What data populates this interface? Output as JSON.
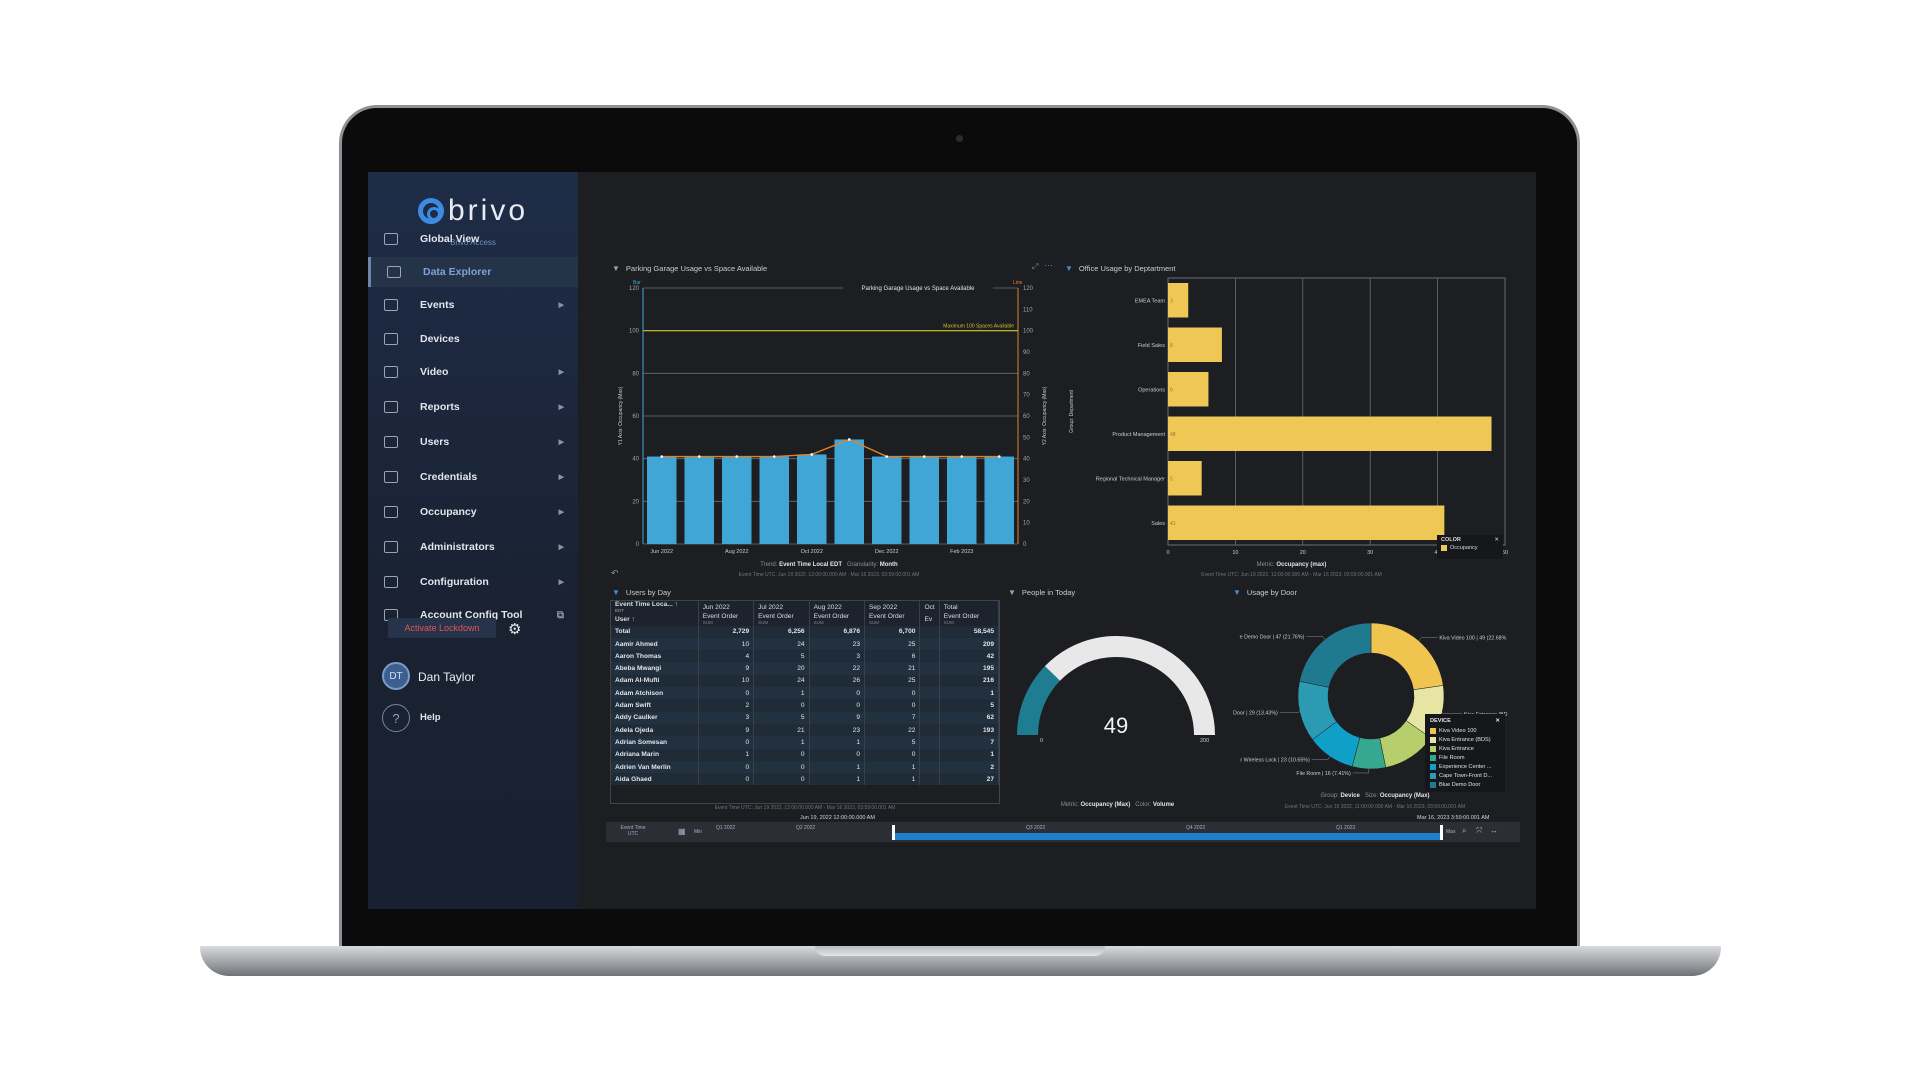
{
  "brand": {
    "name": "brivo",
    "subtitle": "Brivo Access"
  },
  "sidebar": {
    "items": [
      {
        "label": "Global View",
        "icon": "globe-icon",
        "chevron": false
      },
      {
        "label": "Data Explorer",
        "icon": "database-search-icon",
        "chevron": false,
        "active": true
      },
      {
        "label": "Events",
        "icon": "chat-icon",
        "chevron": true
      },
      {
        "label": "Devices",
        "icon": "server-icon",
        "chevron": false
      },
      {
        "label": "Video",
        "icon": "video-icon",
        "chevron": true
      },
      {
        "label": "Reports",
        "icon": "book-icon",
        "chevron": true
      },
      {
        "label": "Users",
        "icon": "user-icon",
        "chevron": true
      },
      {
        "label": "Credentials",
        "icon": "id-card-icon",
        "chevron": true
      },
      {
        "label": "Occupancy",
        "icon": "occupancy-icon",
        "chevron": true
      },
      {
        "label": "Administrators",
        "icon": "admin-icon",
        "chevron": true
      },
      {
        "label": "Configuration",
        "icon": "toolbox-icon",
        "chevron": true
      },
      {
        "label": "Account Config Tool",
        "icon": "brivo-icon",
        "external": true
      }
    ],
    "lockdown_label": "Activate Lockdown",
    "user_initials": "DT",
    "user_name": "Dan Taylor",
    "help_label": "Help"
  },
  "panels": {
    "parking": {
      "title": "Parking Garage Usage vs Space Available",
      "footer_trend_label": "Trend:",
      "footer_trend": "Event Time Local EDT",
      "footer_gran_label": "Granularity:",
      "footer_gran": "Month",
      "footer_time": "Event Time UTC: Jun 19 2022, 12:00:00.000 AM - Mar 16 2023, 03:59:00.001 AM"
    },
    "office": {
      "title": "Office Usage by Deptartment",
      "footer_metric_label": "Metric:",
      "footer_metric": "Occupancy (max)",
      "footer_time": "Event Time UTC: Jun 19 2022, 12:00:00.000 AM - Mar 16 2023, 03:59:00.001 AM",
      "legend_title": "COLOR",
      "legend_item": "Occupancy"
    },
    "users": {
      "title": "Users by Day",
      "footer_time": "Event Time UTC: Jun 19 2022, 12:00:00.000 AM - Mar 16 2023, 03:59:00.001 AM"
    },
    "people": {
      "title": "People in Today",
      "footer_metric_label": "Metric:",
      "footer_metric": "Occupancy (Max)",
      "footer_color_label": "Color:",
      "footer_color": "Volume"
    },
    "door": {
      "title": "Usage by Door",
      "footer_group_label": "Group:",
      "footer_group": "Device",
      "footer_size_label": "Size:",
      "footer_size": "Occupancy (Max)",
      "footer_time": "Event Time UTC: Jun 19 2022, 11:00:00.000 AM - Mar 16 2023, 03:59:00.001 AM",
      "legend_title": "DEVICE"
    }
  },
  "table": {
    "corner_top": "Event Time Loca...",
    "corner_top_sub": "EDT",
    "corner_user": "User",
    "months": [
      "Jun 2022",
      "Jul 2022",
      "Aug 2022",
      "Sep 2022",
      "Oct",
      "Total"
    ],
    "measure": "Event Order",
    "measure_sub": "SUM",
    "measure_trunc": "Ev",
    "rows": [
      [
        "Total",
        "2,729",
        "6,256",
        "6,876",
        "6,700",
        "",
        "58,545"
      ],
      [
        "Aamir Ahmed",
        "10",
        "24",
        "23",
        "25",
        "",
        "209"
      ],
      [
        "Aaron Thomas",
        "4",
        "5",
        "3",
        "6",
        "",
        "42"
      ],
      [
        "Abeba Mwangi",
        "9",
        "20",
        "22",
        "21",
        "",
        "195"
      ],
      [
        "Adam Al-Mufti",
        "10",
        "24",
        "26",
        "25",
        "",
        "216"
      ],
      [
        "Adam Atchison",
        "0",
        "1",
        "0",
        "0",
        "",
        "1"
      ],
      [
        "Adam Swift",
        "2",
        "0",
        "0",
        "0",
        "",
        "5"
      ],
      [
        "Addy Caulker",
        "3",
        "5",
        "9",
        "7",
        "",
        "62"
      ],
      [
        "Adela Ojeda",
        "9",
        "21",
        "23",
        "22",
        "",
        "193"
      ],
      [
        "Adrian Somesan",
        "0",
        "1",
        "1",
        "5",
        "",
        "7"
      ],
      [
        "Adriana Marin",
        "1",
        "0",
        "0",
        "0",
        "",
        "1"
      ],
      [
        "Adrien Van Merlin",
        "0",
        "0",
        "1",
        "1",
        "",
        "2"
      ],
      [
        "Aida Ghaed",
        "0",
        "0",
        "1",
        "1",
        "",
        "27"
      ]
    ]
  },
  "timeline": {
    "label": "Event Time",
    "label_sub": "UTC",
    "min": "Min",
    "max": "Max",
    "quarters": [
      "Q1 2022",
      "Q2 2022",
      "Q3 2022",
      "Q4 2022",
      "Q1 2023"
    ],
    "start": "Jun 19, 2022 12:00:00.000 AM",
    "end": "Mar 16, 2023 3:59:00.001 AM"
  },
  "chart_data": [
    {
      "type": "bar",
      "title": "Parking Garage Usage vs Space Available",
      "legend_bar": "Bar",
      "legend_line": "Line",
      "categories": [
        "Jun 2022",
        "Jul 2022",
        "Aug 2022",
        "Sep 2022",
        "Oct 2022",
        "Nov 2022",
        "Dec 2022",
        "Jan 2023",
        "Feb 2023",
        "Mar 2023"
      ],
      "x_tick_labels": [
        "Jun 2022",
        "",
        "Aug 2022",
        "",
        "Oct 2022",
        "",
        "Dec 2022",
        "",
        "Feb 2023",
        ""
      ],
      "series": [
        {
          "name": "Bar",
          "type": "bar",
          "values": [
            41,
            41,
            41,
            41,
            42,
            49,
            41,
            41,
            41,
            41
          ],
          "color": "#3fa6d6"
        },
        {
          "name": "Line",
          "type": "line",
          "values": [
            41,
            41,
            41,
            41,
            42,
            49,
            41,
            41,
            41,
            41
          ],
          "color": "#e0822a"
        }
      ],
      "reference_line": {
        "value": 100,
        "label": "Maximum 100 Spaces Available",
        "color": "#c8c22a"
      },
      "ylabel": "Y1 Axis: Occupancy (Max)",
      "y2label": "Y2 Axis: Occupancy (Max)",
      "ylim": [
        0,
        120
      ],
      "y2lim": [
        0,
        120
      ],
      "yticks": [
        0,
        20,
        40,
        60,
        80,
        100,
        120
      ],
      "y2ticks": [
        0,
        10,
        20,
        30,
        40,
        50,
        60,
        70,
        80,
        90,
        100,
        110,
        120
      ],
      "grid": true
    },
    {
      "type": "bar",
      "orientation": "horizontal",
      "title": "Office Usage by Deptartment",
      "categories": [
        "EMEA Team",
        "Field Sales",
        "Operations",
        "Product Management",
        "Regional Technical Manager",
        "Sales"
      ],
      "values": [
        3,
        8,
        6,
        48,
        5,
        41
      ],
      "color": "#eec755",
      "ylabel": "Group: Department",
      "xlim": [
        0,
        50
      ],
      "xticks": [
        0,
        10,
        20,
        30,
        40,
        50
      ],
      "grid": true,
      "legend": "bottom-right"
    },
    {
      "type": "gauge",
      "title": "People in Today",
      "value": 49,
      "min": 0,
      "max": 200,
      "fill_color": "#1f7d92",
      "track_color": "#e8e8e8"
    },
    {
      "type": "pie",
      "donut": true,
      "title": "Usage by Door",
      "legend": "right",
      "slices": [
        {
          "name": "Kiva Video 100",
          "value": 49,
          "label": "Kiva Video 100 | 49 (22.68%",
          "color": "#efc54f"
        },
        {
          "name": "Kiva Entrance (BDS)",
          "value": 26,
          "label": "Kiva Entrance (BD",
          "color": "#e6e5a3"
        },
        {
          "name": "Kiva Entrance",
          "value": 26,
          "label": "",
          "color": "#b6cf6c"
        },
        {
          "name": "File Room",
          "value": 16,
          "label": "File Room | 16 (7.41%)",
          "color": "#36a88f"
        },
        {
          "name": "Experience Center ...",
          "value": 23,
          "label": "r Wireless Lock | 23 (10.65%)",
          "color": "#0f9fc7"
        },
        {
          "name": "Cape Town-Front D...",
          "value": 29,
          "label": "Door | 29 (13.43%)",
          "color": "#2a9bb2"
        },
        {
          "name": "Blue Demo Door",
          "value": 47,
          "label": "e Demo Door | 47 (21.76%)",
          "color": "#1f7a8f"
        }
      ]
    }
  ]
}
